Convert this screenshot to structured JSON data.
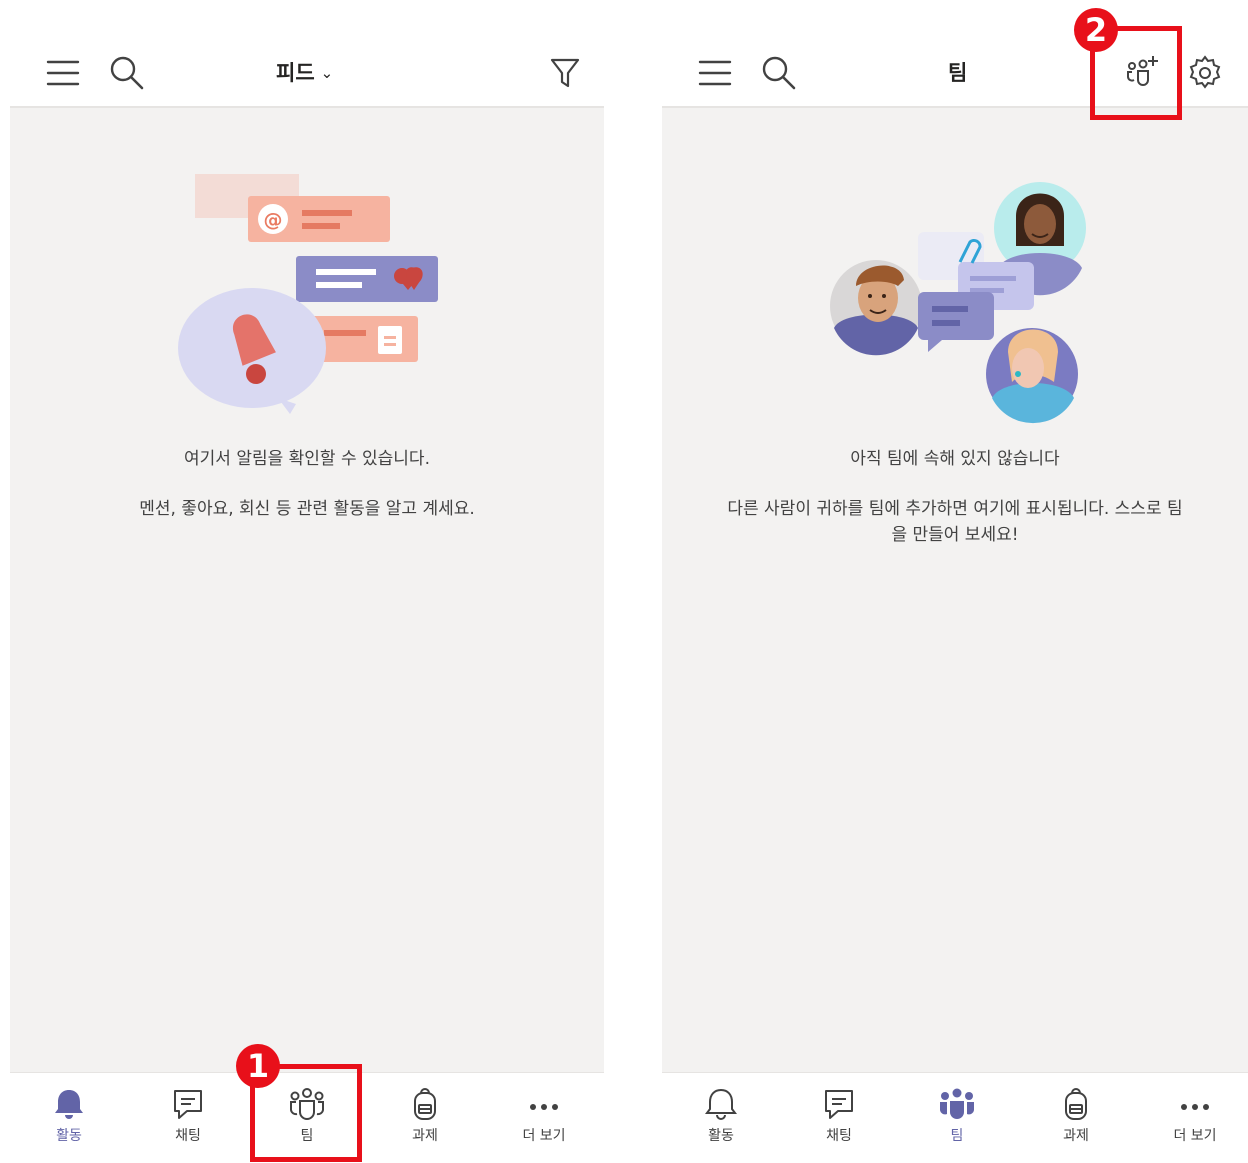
{
  "left_screen": {
    "header": {
      "title": "피드",
      "title_chevron": "⌄"
    },
    "empty_state": {
      "title": "여기서 알림을 확인할 수 있습니다.",
      "body": "멘션, 좋아요, 회신 등 관련 활동을 알고 계세요."
    },
    "nav": {
      "activity": "활동",
      "chat": "채팅",
      "teams": "팀",
      "assignments": "과제",
      "more": "더 보기"
    },
    "active_tab": "activity"
  },
  "right_screen": {
    "header": {
      "title": "팀"
    },
    "empty_state": {
      "title": "아직 팀에 속해 있지 않습니다",
      "body": "다른 사람이 귀하를 팀에 추가하면 여기에 표시됩니다. 스스로 팀을 만들어 보세요!"
    },
    "nav": {
      "activity": "활동",
      "chat": "채팅",
      "teams": "팀",
      "assignments": "과제",
      "more": "더 보기"
    },
    "active_tab": "teams"
  },
  "annotations": {
    "step1": "1",
    "step2": "2"
  },
  "colors": {
    "accent": "#6264a7",
    "callout": "#e8101a",
    "content_bg": "#f3f2f1"
  }
}
